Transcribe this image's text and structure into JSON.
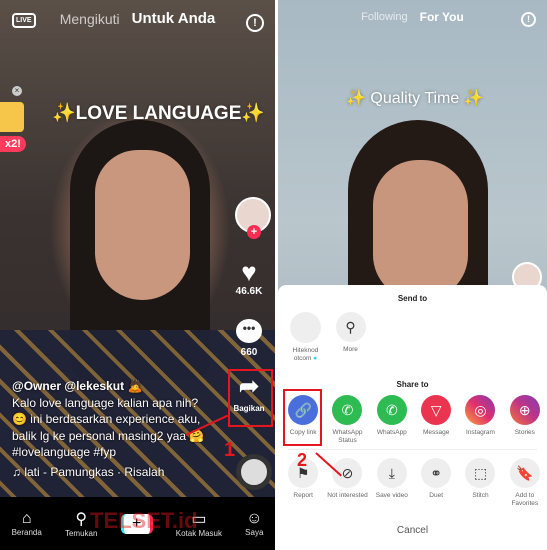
{
  "left": {
    "live_label": "LIVE",
    "tabs": [
      "Mengikuti",
      "Untuk Anda"
    ],
    "video_title": "✨LOVE LANGUAGE✨",
    "promo_badge": "x2!",
    "likes": "46.6K",
    "comments": "660",
    "share_label": "Bagikan",
    "caption": {
      "author": "@Owner @lekeskut 🙇",
      "lines": [
        "Kalo love language kalian apa nih?",
        "😊 ini berdasarkan experience aku,",
        "balik lg ke personal masing2 yaa 🤗",
        "#lovelanguage #fyp"
      ],
      "music": "lati - Pamungkas · Risalah"
    },
    "step_number": "1",
    "nav": [
      {
        "label": "Beranda",
        "icon": "home-icon"
      },
      {
        "label": "Temukan",
        "icon": "search-icon"
      },
      {
        "label": "+",
        "icon": "plus-icon"
      },
      {
        "label": "Kotak Masuk",
        "icon": "inbox-icon"
      },
      {
        "label": "Saya",
        "icon": "profile-icon"
      }
    ],
    "watermark": "TELSET.id"
  },
  "right": {
    "tabs": [
      "Following",
      "For You"
    ],
    "video_title": "✨ Quality Time ✨",
    "sheet": {
      "send_to": "Send to",
      "contacts": [
        {
          "label": "Hiteknod otcom",
          "verified": true
        },
        {
          "label": "More",
          "icon": "search-icon"
        }
      ],
      "share_to": "Share to",
      "share": [
        {
          "label": "Copy link",
          "icon": "link-icon",
          "color": "#4a6fdc"
        },
        {
          "label": "WhatsApp Status",
          "icon": "whatsapp-icon",
          "color": "#2dbb52"
        },
        {
          "label": "WhatsApp",
          "icon": "whatsapp-icon",
          "color": "#2dbb52"
        },
        {
          "label": "Message",
          "icon": "send-icon",
          "color": "#ea3450"
        },
        {
          "label": "Instagram",
          "icon": "instagram-icon",
          "color": "#c13584"
        },
        {
          "label": "Stories",
          "icon": "stories-icon",
          "color": "#b43ca0"
        }
      ],
      "actions": [
        {
          "label": "Report",
          "icon": "flag-icon"
        },
        {
          "label": "Not interested",
          "icon": "block-icon"
        },
        {
          "label": "Save video",
          "icon": "download-icon"
        },
        {
          "label": "Duet",
          "icon": "duet-icon"
        },
        {
          "label": "Stitch",
          "icon": "stitch-icon"
        },
        {
          "label": "Add to Favorites",
          "icon": "bookmark-icon"
        }
      ],
      "cancel": "Cancel"
    },
    "step_number": "2"
  },
  "colors": {
    "annotation": "#e5161d"
  }
}
